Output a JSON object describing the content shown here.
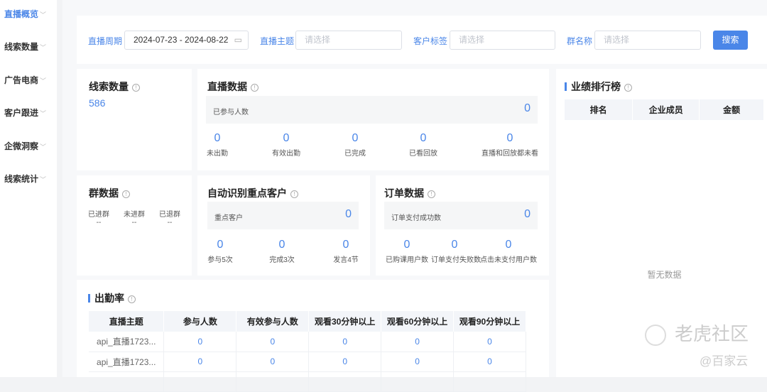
{
  "sidebar": {
    "items": [
      {
        "label": "直播概览",
        "active": true
      },
      {
        "label": "线索数量"
      },
      {
        "label": "广告电商"
      },
      {
        "label": "客户跟进"
      },
      {
        "label": "企微洞察"
      },
      {
        "label": "线索统计"
      }
    ]
  },
  "filters": {
    "period_label": "直播周期",
    "period_value": "2024-07-23 - 2024-08-22",
    "topic_label": "直播主题",
    "topic_placeholder": "请选择",
    "tag_label": "客户标签",
    "tag_placeholder": "请选择",
    "group_label": "群名称",
    "group_placeholder": "请选择",
    "search_label": "搜索"
  },
  "leads": {
    "title": "线索数量",
    "value": "586"
  },
  "live": {
    "title": "直播数据",
    "participants_label": "已参与人数",
    "participants_value": "0",
    "stats": [
      {
        "n": "0",
        "l": "未出勤"
      },
      {
        "n": "0",
        "l": "有效出勤"
      },
      {
        "n": "0",
        "l": "已完成"
      },
      {
        "n": "0",
        "l": "已看回放"
      },
      {
        "n": "0",
        "l": "直播和回放都未看"
      }
    ]
  },
  "group": {
    "title": "群数据",
    "stats": [
      {
        "l": "已进群",
        "n": "--"
      },
      {
        "l": "未进群",
        "n": "--"
      },
      {
        "l": "已退群",
        "n": "--"
      }
    ]
  },
  "auto": {
    "title": "自动识别重点客户",
    "key_label": "重点客户",
    "key_value": "0",
    "stats": [
      {
        "n": "0",
        "l": "参与5次"
      },
      {
        "n": "0",
        "l": "完成3次"
      },
      {
        "n": "0",
        "l": "发言4节"
      }
    ]
  },
  "order": {
    "title": "订单数据",
    "paid_label": "订单支付成功数",
    "paid_value": "0",
    "stats": [
      {
        "n": "0",
        "l": "已购课用户数"
      },
      {
        "n": "0",
        "l": "订单支付失败数"
      },
      {
        "n": "0",
        "l": "点击未支付用户数"
      }
    ]
  },
  "attendance": {
    "title": "出勤率",
    "columns": [
      "直播主题",
      "参与人数",
      "有效参与人数",
      "观看30分钟以上",
      "观看60分钟以上",
      "观看90分钟以上"
    ],
    "rows": [
      [
        "api_直播1723...",
        "0",
        "0",
        "0",
        "0",
        "0"
      ],
      [
        "api_直播1723...",
        "0",
        "0",
        "0",
        "0",
        "0"
      ]
    ]
  },
  "ranking": {
    "title": "业绩排行榜",
    "columns": [
      "排名",
      "企业成员",
      "金额"
    ],
    "empty": "暂无数据"
  },
  "watermark": {
    "line1": "老虎社区",
    "line2": "@百家云"
  }
}
